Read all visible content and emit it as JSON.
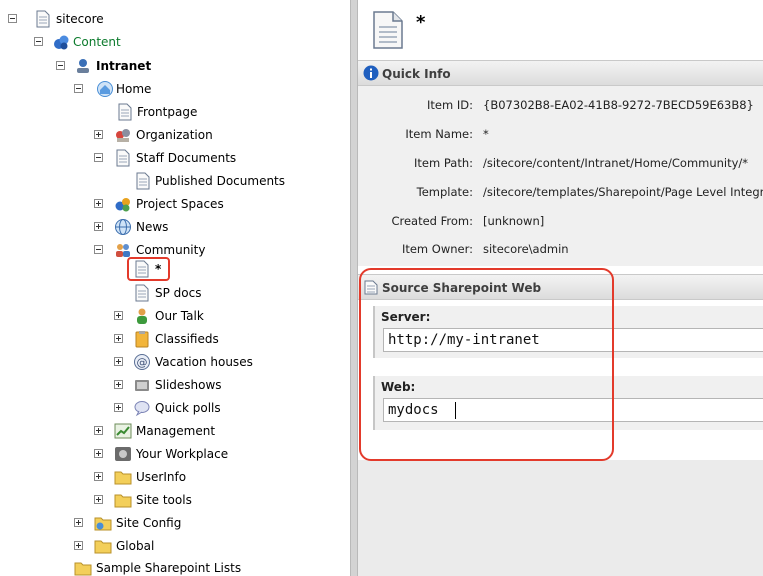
{
  "tree": {
    "root": "sitecore",
    "content": "Content",
    "intranet": "Intranet",
    "home": "Home",
    "frontpage": "Frontpage",
    "organization": "Organization",
    "staff_documents": "Staff Documents",
    "published_documents": "Published Documents",
    "project_spaces": "Project Spaces",
    "news": "News",
    "community": "Community",
    "star_item": "*",
    "sp_docs": "SP docs",
    "our_talk": "Our Talk",
    "classifieds": "Classifieds",
    "vacation_houses": "Vacation houses",
    "slideshows": "Slideshows",
    "quick_polls": "Quick polls",
    "management": "Management",
    "your_workplace": "Your Workplace",
    "userinfo": "UserInfo",
    "site_tools": "Site tools",
    "site_config": "Site Config",
    "global": "Global",
    "sample_sharepoint_lists": "Sample Sharepoint Lists"
  },
  "item": {
    "title": "*"
  },
  "quick_info": {
    "heading": "Quick Info",
    "rows": [
      {
        "key": "Item ID:",
        "value": "{B07302B8-EA02-41B8-9272-7BECD59E63B8}"
      },
      {
        "key": "Item Name:",
        "value": "*"
      },
      {
        "key": "Item Path:",
        "value": "/sitecore/content/Intranet/Home/Community/*"
      },
      {
        "key": "Template:",
        "value": "/sitecore/templates/Sharepoint/Page Level Integrat"
      },
      {
        "key": "Created From:",
        "value": "[unknown]"
      },
      {
        "key": "Item Owner:",
        "value": "sitecore\\admin"
      }
    ]
  },
  "source_section": {
    "heading": "Source Sharepoint Web",
    "server_label": "Server:",
    "server_value": "http://my-intranet",
    "web_label": "Web:",
    "web_value": "mydocs"
  },
  "colors": {
    "highlight": "#e33a2b",
    "green_label": "#0b7a2c"
  }
}
